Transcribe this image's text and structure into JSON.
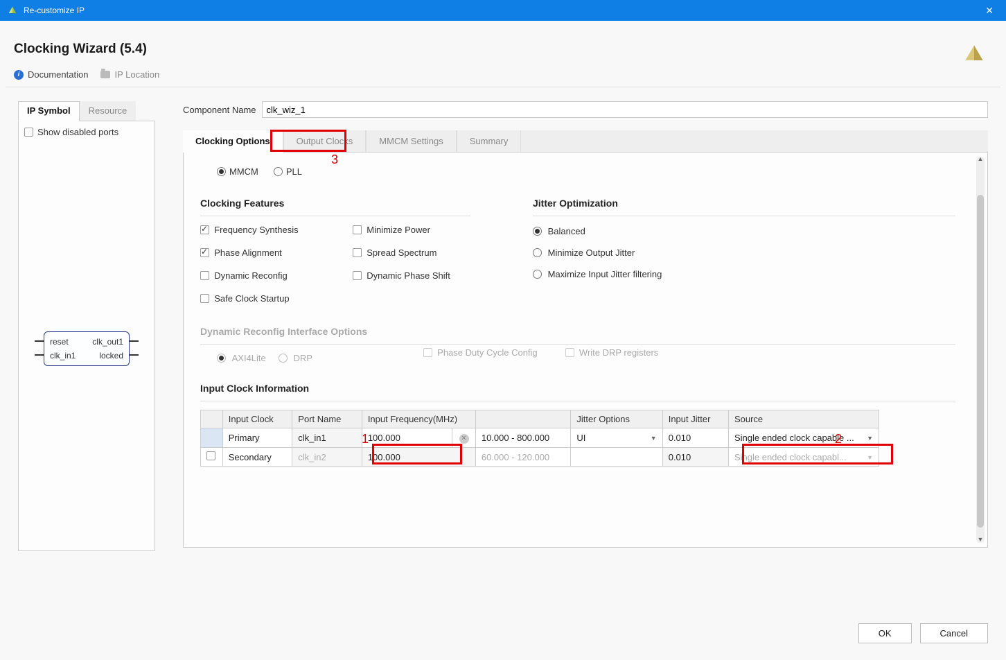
{
  "window": {
    "title": "Re-customize IP"
  },
  "heading": "Clocking Wizard (5.4)",
  "toolbar": {
    "documentation": "Documentation",
    "ip_location": "IP Location"
  },
  "left": {
    "tabs": {
      "symbol": "IP Symbol",
      "resource": "Resource"
    },
    "show_disabled": "Show disabled ports",
    "ports": {
      "reset": "reset",
      "clk_out1": "clk_out1",
      "clk_in1": "clk_in1",
      "locked": "locked"
    }
  },
  "component": {
    "label": "Component Name",
    "value": "clk_wiz_1"
  },
  "main_tabs": {
    "clocking": "Clocking Options",
    "output": "Output Clocks",
    "mmcm": "MMCM Settings",
    "summary": "Summary"
  },
  "primitive": {
    "mmcm": "MMCM",
    "pll": "PLL"
  },
  "features": {
    "title": "Clocking Features",
    "freq_synth": "Frequency Synthesis",
    "phase_align": "Phase Alignment",
    "dyn_recfg": "Dynamic Reconfig",
    "safe_clk": "Safe Clock Startup",
    "min_power": "Minimize Power",
    "spread": "Spread Spectrum",
    "dyn_phase": "Dynamic Phase Shift"
  },
  "jitter": {
    "title": "Jitter Optimization",
    "balanced": "Balanced",
    "min_out": "Minimize Output Jitter",
    "max_in": "Maximize Input Jitter filtering"
  },
  "dyn_opts": {
    "title": "Dynamic Reconfig Interface Options",
    "axi": "AXI4Lite",
    "drp": "DRP",
    "phase_duty": "Phase Duty Cycle Config",
    "write_drp": "Write DRP registers"
  },
  "clk_table": {
    "title": "Input Clock Information",
    "headers": {
      "input_clock": "Input Clock",
      "port_name": "Port Name",
      "input_freq": "Input Frequency(MHz)",
      "range": "",
      "jitter_opts": "Jitter Options",
      "input_jitter": "Input Jitter",
      "source": "Source"
    },
    "rows": [
      {
        "name": "Primary",
        "port": "clk_in1",
        "freq": "100.000",
        "range": "10.000 - 800.000",
        "jitter_opt": "UI",
        "jitter": "0.010",
        "source": "Single ended clock capable ...",
        "enabled": true
      },
      {
        "name": "Secondary",
        "port": "clk_in2",
        "freq": "100.000",
        "range": "60.000 - 120.000",
        "jitter_opt": "",
        "jitter": "0.010",
        "source": "Single ended clock capabl...",
        "enabled": false
      }
    ]
  },
  "annotations": {
    "a1": "1",
    "a2": "2",
    "a3": "3"
  },
  "buttons": {
    "ok": "OK",
    "cancel": "Cancel"
  }
}
